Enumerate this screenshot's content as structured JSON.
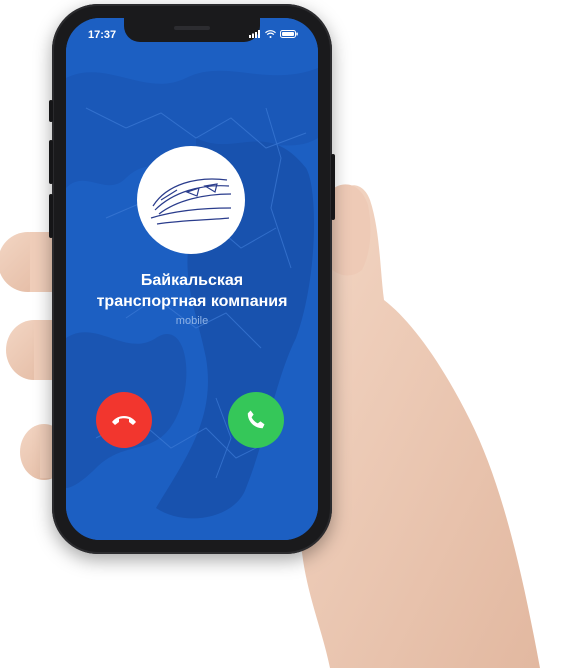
{
  "status_bar": {
    "time": "17:37",
    "icons": [
      "signal-icon",
      "wifi-icon",
      "battery-icon"
    ]
  },
  "call": {
    "caller_name": "Байкальская\nтранспортная компания",
    "caller_label": "mobile",
    "avatar": "train-logo-icon",
    "decline_icon": "phone-hangup-icon",
    "accept_icon": "phone-answer-icon"
  },
  "colors": {
    "screen_background": "#1c5fc2",
    "decline": "#f2362e",
    "accept": "#35c759"
  }
}
